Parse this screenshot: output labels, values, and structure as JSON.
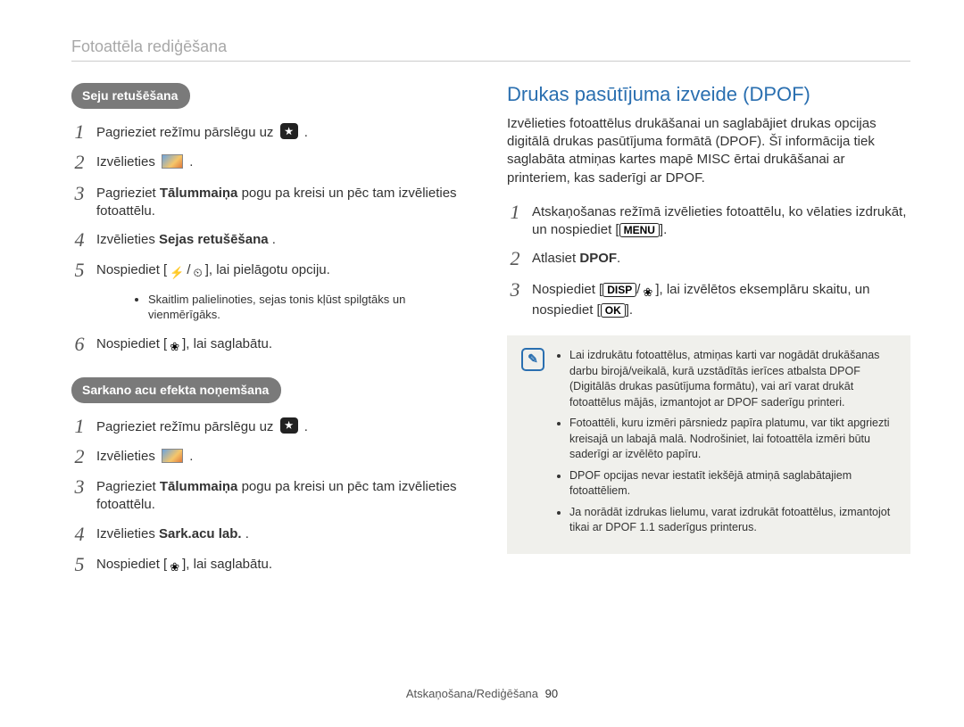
{
  "header": {
    "title": "Fotoattēla rediģēšana"
  },
  "footer": {
    "section": "Atskaņošana/Rediģēšana",
    "page": "90"
  },
  "left": {
    "pill1": "Seju retušēšana",
    "s1": {
      "pre": "Pagrieziet režīmu pārslēgu uz ",
      "post": "."
    },
    "s2": {
      "pre": "Izvēlieties ",
      "post": "."
    },
    "s3": {
      "pre": "Pagrieziet ",
      "bold": "Tālummaiņa",
      "post": " pogu pa kreisi un pēc tam izvēlieties fotoattēlu."
    },
    "s4": {
      "pre": "Izvēlieties ",
      "bold": "Sejas retušēšana",
      "post": "."
    },
    "s5": {
      "pre": "Nospiediet [",
      "mid": "], lai pielāgotu opciju."
    },
    "s5_note": "Skaitlim palielinoties, sejas tonis kļūst spilgtāks un vienmērīgāks.",
    "s6": {
      "pre": "Nospiediet [",
      "post": "], lai saglabātu."
    },
    "pill2": "Sarkano acu efekta noņemšana",
    "r1": {
      "pre": "Pagrieziet režīmu pārslēgu uz ",
      "post": "."
    },
    "r2": {
      "pre": "Izvēlieties ",
      "post": "."
    },
    "r3": {
      "pre": "Pagrieziet ",
      "bold": "Tālummaiņa",
      "post": " pogu pa kreisi un pēc tam izvēlieties fotoattēlu."
    },
    "r4": {
      "pre": "Izvēlieties ",
      "bold": "Sark.acu lab.",
      "post": "."
    },
    "r5": {
      "pre": "Nospiediet [",
      "post": "], lai saglabātu."
    }
  },
  "right": {
    "title": "Drukas pasūtījuma izveide (DPOF)",
    "intro": "Izvēlieties fotoattēlus drukāšanai un saglabājiet drukas opcijas digitālā drukas pasūtījuma formātā (DPOF). Šī informācija tiek saglabāta atmiņas kartes mapē MISC ērtai drukāšanai ar printeriem, kas saderīgi ar DPOF.",
    "d1": {
      "pre": "Atskaņošanas režīmā izvēlieties fotoattēlu, ko vēlaties izdrukāt, un nospiediet [",
      "btn": "MENU",
      "post": "]."
    },
    "d2": {
      "pre": "Atlasiet ",
      "bold": "DPOF",
      "post": "."
    },
    "d3": {
      "pre": "Nospiediet [",
      "btn1": "DISP",
      "sep": "/",
      "mid": "], lai izvēlētos eksemplāru skaitu, un nospiediet [",
      "btn2": "OK",
      "post": "]."
    },
    "note_glyph": "✎",
    "notes": [
      "Lai izdrukātu fotoattēlus, atmiņas karti var nogādāt drukāšanas darbu birojā/veikalā, kurā uzstādītās ierīces atbalsta DPOF (Digitālās drukas pasūtījuma formātu), vai arī varat drukāt fotoattēlus mājās, izmantojot ar DPOF saderīgu printeri.",
      "Fotoattēli, kuru izmēri pārsniedz papīra platumu, var tikt apgriezti kreisajā un labajā malā. Nodrošiniet, lai fotoattēla izmēri būtu saderīgi ar izvēlēto papīru.",
      "DPOF opcijas nevar iestatīt iekšējā atmiņā saglabātajiem fotoattēliem.",
      "Ja norādāt izdrukas lielumu, varat izdrukāt fotoattēlus, izmantojot tikai ar DPOF 1.1 saderīgus printerus."
    ]
  }
}
